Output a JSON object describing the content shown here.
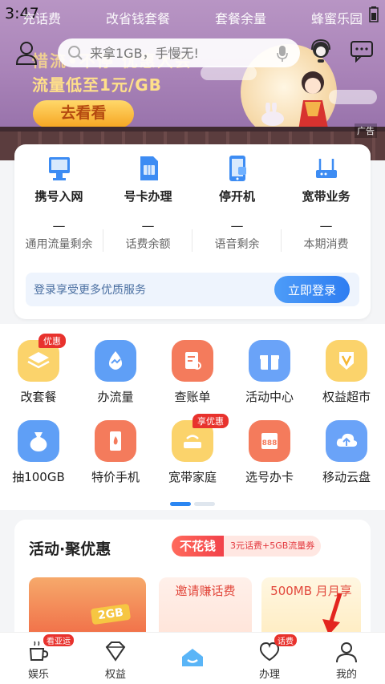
{
  "status": {
    "time": "3:47"
  },
  "top_tabs": [
    "充话费",
    "改省钱套餐",
    "套餐余量",
    "蜂蜜乐园"
  ],
  "search": {
    "placeholder": "来拿1GB，手慢无!"
  },
  "banner": {
    "title": "惜流•不停 优惠大会",
    "subtitle": "流量低至1元/GB",
    "button": "去看看",
    "ad_tag": "广告"
  },
  "quick_actions": [
    {
      "label": "携号入网",
      "icon": "computer-icon"
    },
    {
      "label": "号卡办理",
      "icon": "sim-card-icon"
    },
    {
      "label": "停开机",
      "icon": "phone-icon"
    },
    {
      "label": "宽带业务",
      "icon": "router-icon"
    }
  ],
  "balances": [
    {
      "value": "—",
      "label": "通用流量剩余"
    },
    {
      "value": "—",
      "label": "话费余额"
    },
    {
      "value": "—",
      "label": "语音剩余"
    },
    {
      "value": "—",
      "label": "本期消费"
    }
  ],
  "login": {
    "text": "登录享受更多优质服务",
    "button": "立即登录"
  },
  "services": [
    {
      "label": "改套餐",
      "badge": "优惠",
      "icon": "layers-icon",
      "color": "#f6b733"
    },
    {
      "label": "办流量",
      "badge": "",
      "icon": "drop-icon",
      "color": "#3d8cf3"
    },
    {
      "label": "查账单",
      "badge": "",
      "icon": "bill-search-icon",
      "color": "#f26a4a"
    },
    {
      "label": "活动中心",
      "badge": "",
      "icon": "gift-icon",
      "color": "#4c8ff6"
    },
    {
      "label": "权益超市",
      "badge": "",
      "icon": "v-badge-icon",
      "color": "#f6b733"
    },
    {
      "label": "抽100GB",
      "badge": "",
      "icon": "bag-icon",
      "color": "#3d8cf3"
    },
    {
      "label": "特价手机",
      "badge": "",
      "icon": "hot-phone-icon",
      "color": "#f26a4a"
    },
    {
      "label": "宽带家庭",
      "badge": "享优惠",
      "icon": "wifi-icon",
      "color": "#f6b733"
    },
    {
      "label": "选号办卡",
      "badge": "",
      "icon": "number-card-icon",
      "color": "#f26a4a"
    },
    {
      "label": "移动云盘",
      "badge": "",
      "icon": "cloud-upload-icon",
      "color": "#3d8cf3"
    }
  ],
  "activity": {
    "title": "活动·聚优惠",
    "chip_main": "不花钱",
    "chip_sub": "3元话费+5GB流量券",
    "promo_1": "2GB",
    "promo_2": "邀请赚话费",
    "promo_3": "500MB 月月享"
  },
  "bottom_nav": [
    {
      "label": "娱乐",
      "tag": "看亚运",
      "icon": "cup-icon"
    },
    {
      "label": "权益",
      "tag": "",
      "icon": "diamond-icon"
    },
    {
      "label": "",
      "tag": "",
      "icon": "home-icon"
    },
    {
      "label": "办理",
      "tag": "话费",
      "icon": "heart-icon"
    },
    {
      "label": "我的",
      "tag": "",
      "icon": "person-icon"
    }
  ],
  "colors": {
    "accent": "#2b86f2",
    "badge": "#e8322d",
    "banner": "#a983b8"
  }
}
